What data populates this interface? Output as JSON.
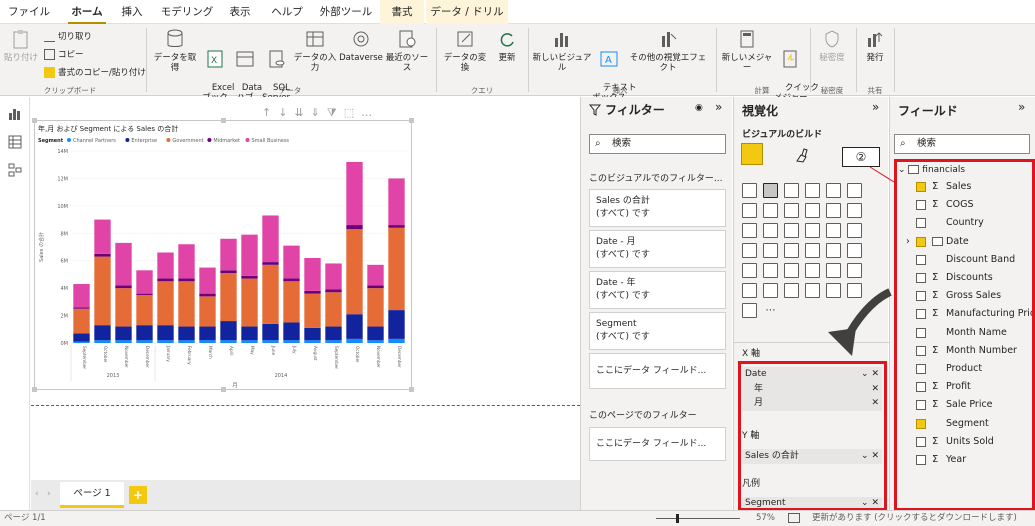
{
  "tabs": [
    "ファイル",
    "ホーム",
    "挿入",
    "モデリング",
    "表示",
    "ヘルプ",
    "外部ツール",
    "書式",
    "データ / ドリル"
  ],
  "ribbon": {
    "paste": "貼り付け",
    "cut": "切り取り",
    "copy": "コピー",
    "format_painter": "書式のコピー/貼り付け",
    "clipboard_group": "クリップボード",
    "get_data": "データを取得",
    "excel": "Excel\nブック",
    "data_hub": "Data\nハブ",
    "sql": "SQL\nServer",
    "enter_data": "データの入力",
    "dataverse": "Dataverse",
    "recent": "最近のソース",
    "data_group": "データ",
    "transform": "データの変換",
    "refresh": "更新",
    "query_group": "クエリ",
    "new_visual": "新しいビジュアル",
    "textbox": "テキスト\nボックス",
    "more_visuals": "その他の視覚エフェクト",
    "insert_group": "挿入",
    "new_measure": "新しいメジャー",
    "quick_measure": "クイック\nメジャー",
    "calc_group": "計算",
    "sensitivity": "秘密度",
    "sensitivity_group": "秘密度",
    "publish": "発行",
    "share_group": "共有"
  },
  "chart_data": {
    "type": "bar",
    "stacked": true,
    "title": "年,月 および Segment による Sales の合計",
    "legend_title": "Segment",
    "legend_position": "top-left",
    "ylabel": "Sales の合計",
    "xlabel": "月",
    "ylim": [
      0,
      14000000
    ],
    "yticks": [
      "0M",
      "2M",
      "4M",
      "6M",
      "8M",
      "10M",
      "12M",
      "14M"
    ],
    "categories": [
      "September",
      "October",
      "November",
      "December",
      "January",
      "February",
      "March",
      "April",
      "May",
      "June",
      "July",
      "August",
      "September",
      "October",
      "November",
      "December"
    ],
    "years": [
      {
        "label": "2013",
        "start": 0,
        "end": 3
      },
      {
        "label": "2014",
        "start": 4,
        "end": 15
      }
    ],
    "series": [
      {
        "name": "Channel Partners",
        "color": "#118dff",
        "values": [
          0.1,
          0.2,
          0.2,
          0.2,
          0.2,
          0.2,
          0.2,
          0.2,
          0.2,
          0.2,
          0.2,
          0.2,
          0.2,
          0.3,
          0.2,
          0.3
        ]
      },
      {
        "name": "Enterprise",
        "color": "#12239e",
        "values": [
          0.6,
          1.1,
          1.0,
          1.1,
          1.1,
          1.0,
          1.0,
          1.4,
          1.0,
          1.2,
          1.3,
          0.9,
          1.0,
          1.8,
          1.0,
          2.1
        ]
      },
      {
        "name": "Government",
        "color": "#e66c37",
        "values": [
          1.8,
          5.0,
          2.8,
          2.2,
          3.2,
          3.3,
          2.2,
          3.5,
          3.5,
          4.3,
          3.0,
          2.5,
          2.5,
          6.2,
          2.8,
          6.0
        ]
      },
      {
        "name": "Midmarket",
        "color": "#6b007b",
        "values": [
          0.1,
          0.2,
          0.2,
          0.1,
          0.2,
          0.2,
          0.2,
          0.2,
          0.2,
          0.2,
          0.2,
          0.2,
          0.2,
          0.3,
          0.2,
          0.2
        ]
      },
      {
        "name": "Small Business",
        "color": "#e044a7",
        "values": [
          1.7,
          2.5,
          3.1,
          1.7,
          1.9,
          2.5,
          1.9,
          2.3,
          3.0,
          3.4,
          2.4,
          2.4,
          1.9,
          4.6,
          1.5,
          3.4
        ]
      }
    ]
  },
  "filters": {
    "title": "フィルター",
    "search": "検索",
    "visual_section": "このビジュアルでのフィルター...",
    "cards": [
      {
        "name": "Sales の合計",
        "value": "(すべて) です"
      },
      {
        "name": "Date - 月",
        "value": "(すべて) です"
      },
      {
        "name": "Date - 年",
        "value": "(すべて) です"
      },
      {
        "name": "Segment",
        "value": "(すべて) です"
      }
    ],
    "add_field": "ここにデータ フィールド...",
    "page_section": "このページでのフィルター",
    "add_field_page": "ここにデータ フィールド..."
  },
  "viz": {
    "title": "視覚化",
    "build": "ビジュアルのビルド",
    "callout": "②",
    "x_axis": "X 軸",
    "x_field": "Date",
    "x_sub": [
      "年",
      "月"
    ],
    "y_axis": "Y 軸",
    "y_field": "Sales の合計",
    "legend": "凡例",
    "legend_field": "Segment"
  },
  "fields": {
    "title": "フィールド",
    "search": "検索",
    "table": "financials",
    "items": [
      {
        "name": "Sales",
        "sigma": true,
        "checked": true
      },
      {
        "name": "COGS",
        "sigma": true,
        "checked": false
      },
      {
        "name": "Country",
        "sigma": false,
        "checked": false
      },
      {
        "name": "Date",
        "sigma": false,
        "checked": true,
        "table": true
      },
      {
        "name": "Discount Band",
        "sigma": false,
        "checked": false
      },
      {
        "name": "Discounts",
        "sigma": true,
        "checked": false
      },
      {
        "name": "Gross Sales",
        "sigma": true,
        "checked": false
      },
      {
        "name": "Manufacturing Price",
        "sigma": true,
        "checked": false
      },
      {
        "name": "Month Name",
        "sigma": false,
        "checked": false
      },
      {
        "name": "Month Number",
        "sigma": true,
        "checked": false
      },
      {
        "name": "Product",
        "sigma": false,
        "checked": false
      },
      {
        "name": "Profit",
        "sigma": true,
        "checked": false
      },
      {
        "name": "Sale Price",
        "sigma": true,
        "checked": false
      },
      {
        "name": "Segment",
        "sigma": false,
        "checked": true
      },
      {
        "name": "Units Sold",
        "sigma": true,
        "checked": false
      },
      {
        "name": "Year",
        "sigma": true,
        "checked": false
      }
    ]
  },
  "page": {
    "tab": "ページ 1",
    "add": "+"
  },
  "status": {
    "page": "ページ 1/1",
    "zoom": "57%",
    "update": "更新があります (クリックするとダウンロードします)"
  }
}
